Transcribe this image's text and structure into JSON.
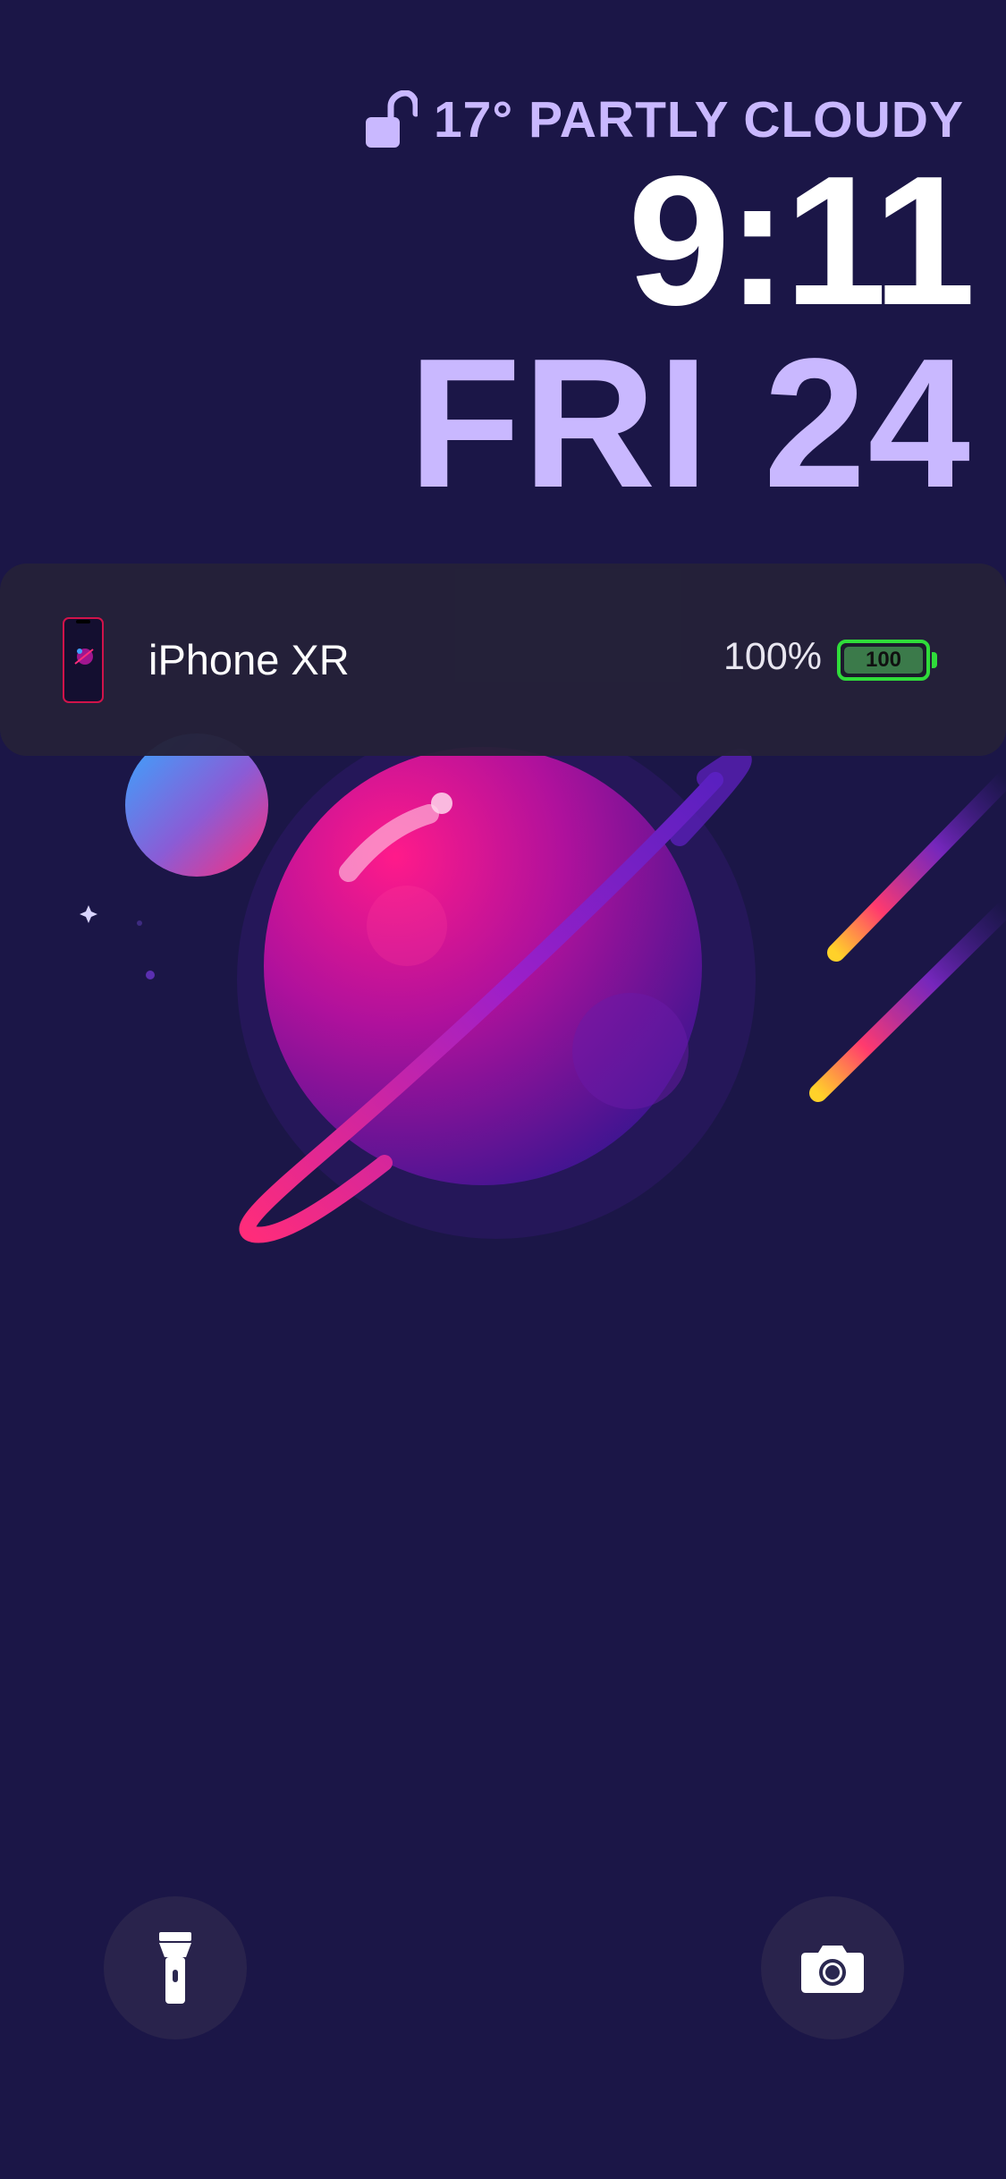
{
  "lock_screen": {
    "weather": "17° PARTLY CLOUDY",
    "time": "9:11",
    "date": "FRI 24"
  },
  "battery_widget": {
    "device_name": "iPhone XR",
    "percent_label": "100%",
    "icon_label": "100",
    "level": 1.0
  },
  "icons": {
    "lock": "unlocked-padlock-icon",
    "flashlight": "flashlight-icon",
    "camera": "camera-icon",
    "device": "iphone-icon"
  },
  "colors": {
    "background": "#1b1647",
    "accent_text": "#c9b8ff",
    "battery_green": "#2fdc3a"
  }
}
